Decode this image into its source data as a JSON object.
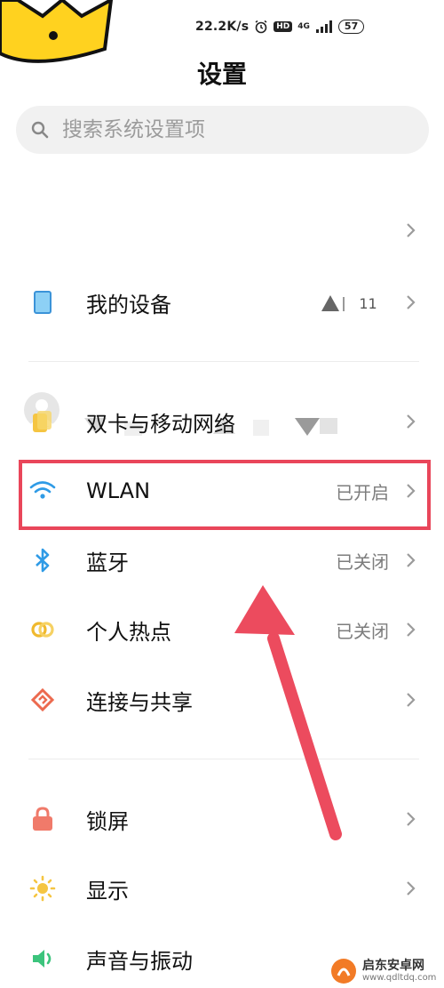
{
  "status_bar": {
    "net_speed": "22.2K/s",
    "hd_label": "HD",
    "network_label": "4G",
    "battery": "57"
  },
  "title": "设置",
  "search": {
    "placeholder": "搜索系统设置项"
  },
  "account": {
    "chevron": "›"
  },
  "items": [
    {
      "label": "我的设备",
      "value": "11",
      "icon": "device-icon",
      "color": "#5aa9e6"
    },
    {
      "label": "双卡与移动网络",
      "value": "",
      "icon": "sim-card-icon",
      "color": "#f5c542"
    },
    {
      "label": "WLAN",
      "value": "已开启",
      "icon": "wifi-icon",
      "color": "#2f9be6"
    },
    {
      "label": "蓝牙",
      "value": "已关闭",
      "icon": "bluetooth-icon",
      "color": "#2f9be6"
    },
    {
      "label": "个人热点",
      "value": "已关闭",
      "icon": "hotspot-icon",
      "color": "#f0b92e"
    },
    {
      "label": "连接与共享",
      "value": "",
      "icon": "share-icon",
      "color": "#ec6a4f"
    },
    {
      "label": "锁屏",
      "value": "",
      "icon": "lock-icon",
      "color": "#f07a6a"
    },
    {
      "label": "显示",
      "value": "",
      "icon": "brightness-icon",
      "color": "#f5c542"
    },
    {
      "label": "声音与振动",
      "value": "",
      "icon": "sound-icon",
      "color": "#3cc47c"
    }
  ],
  "highlight_color": "#e9465a",
  "watermark": {
    "name": "启东安卓网",
    "url": "www.qdltdq.com"
  }
}
